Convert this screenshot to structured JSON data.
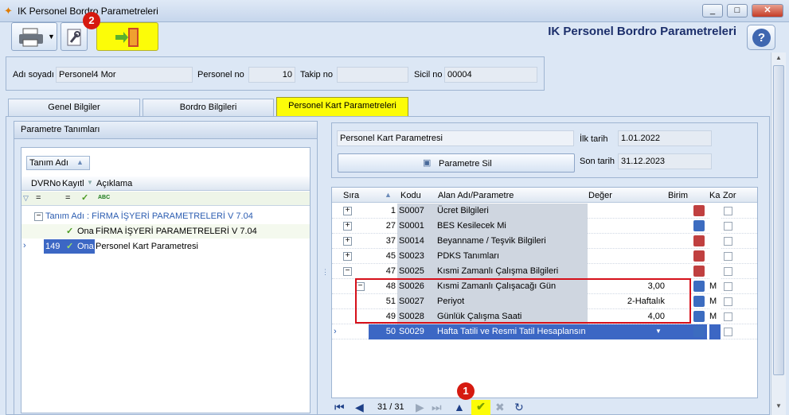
{
  "window": {
    "title": "IK Personel Bordro Parametreleri",
    "min": "_",
    "max": "□",
    "close": "✕"
  },
  "header": {
    "title": "IK Personel Bordro Parametreleri",
    "help": "?"
  },
  "badges": {
    "b1": "1",
    "b2": "2"
  },
  "person": {
    "name_label": "Adı soyadı",
    "name": "Personel4 Mor",
    "no_label": "Personel no",
    "no": "10",
    "takip_label": "Takip no",
    "takip": "",
    "sicil_label": "Sicil no",
    "sicil": "00004"
  },
  "tabs": [
    "Genel Bilgiler",
    "Bordro Bilgileri",
    "Personel Kart Parametreleri"
  ],
  "left": {
    "title": "Parametre Tanımları",
    "group_btn": "Tanım Adı",
    "cols": [
      "DVRNo",
      "Kayıtl",
      "Açıklama"
    ],
    "filter_eq1": "=",
    "filter_eq2": "=",
    "filter_abc": "ABC",
    "group_row": "Tanım Adı : FİRMA İŞYERİ PARAMETRELERİ V 7.04",
    "rows": [
      {
        "dvr": "",
        "status": "Ona",
        "desc": "FİRMA İŞYERİ PARAMETRELERİ V 7.04"
      },
      {
        "dvr": "149",
        "status": "Ona",
        "desc": "Personel Kart Parametresi"
      }
    ]
  },
  "right": {
    "name_field": "Personel Kart Parametresi",
    "ilk_label": "İlk tarih",
    "ilk": "1.01.2022",
    "son_label": "Son tarih",
    "son": "31.12.2023",
    "delete_btn": "Parametre Sil",
    "cols": [
      "Sıra",
      "Kodu",
      "Alan Adı/Parametre",
      "Değer",
      "Birim",
      "Ka",
      "Zor"
    ],
    "rows": [
      {
        "sira": "1",
        "kod": "S0007",
        "ad": "Ücret Bilgileri",
        "deger": "",
        "birim": "",
        "ka": "",
        "exp": "+",
        "lvl": 0
      },
      {
        "sira": "27",
        "kod": "S0001",
        "ad": "BES Kesilecek Mi",
        "deger": "",
        "birim": "",
        "ka": "",
        "exp": "+",
        "lvl": 0
      },
      {
        "sira": "37",
        "kod": "S0014",
        "ad": "Beyanname / Teşvik Bilgileri",
        "deger": "",
        "birim": "",
        "ka": "",
        "exp": "+",
        "lvl": 0
      },
      {
        "sira": "45",
        "kod": "S0023",
        "ad": "PDKS Tanımları",
        "deger": "",
        "birim": "",
        "ka": "",
        "exp": "+",
        "lvl": 0
      },
      {
        "sira": "47",
        "kod": "S0025",
        "ad": "Kısmi Zamanlı Çalışma Bilgileri",
        "deger": "",
        "birim": "",
        "ka": "",
        "exp": "−",
        "lvl": 0
      },
      {
        "sira": "48",
        "kod": "S0026",
        "ad": "Kısmi Zamanlı Çalışacağı Gün",
        "deger": "3,00",
        "birim": "",
        "ka": "M",
        "exp": "−",
        "lvl": 1
      },
      {
        "sira": "51",
        "kod": "S0027",
        "ad": "Periyot",
        "deger": "2-Haftalık",
        "birim": "",
        "ka": "M",
        "exp": "",
        "lvl": 1
      },
      {
        "sira": "49",
        "kod": "S0028",
        "ad": "Günlük Çalışma Saati",
        "deger": "4,00",
        "birim": "",
        "ka": "M",
        "exp": "",
        "lvl": 1
      },
      {
        "sira": "50",
        "kod": "S0029",
        "ad": "Hafta Tatili ve Resmi Tatil Hesaplansın",
        "deger": "",
        "birim": "",
        "ka": "",
        "exp": "",
        "lvl": 1
      }
    ]
  },
  "nav": {
    "counter": "31 / 31"
  },
  "colors": {
    "accent": "#fcfc08",
    "selected": "#3c67c4",
    "highlight_box": "#d6101a"
  }
}
